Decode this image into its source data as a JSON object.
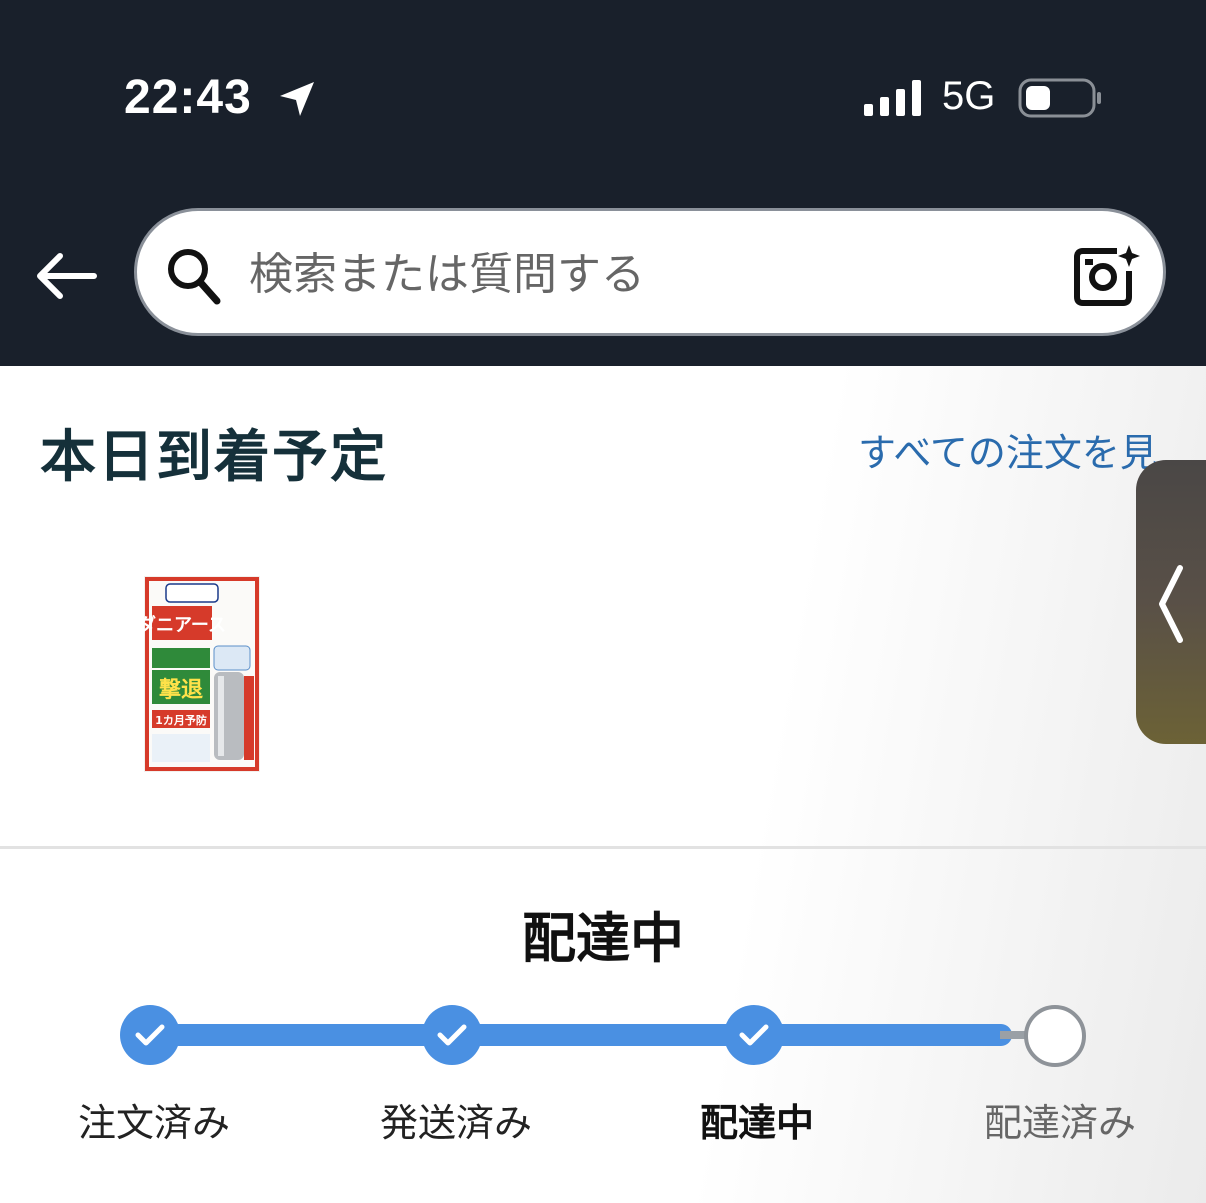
{
  "status_bar": {
    "time": "22:43",
    "network": "5G"
  },
  "search": {
    "placeholder": "検索または質問する"
  },
  "section": {
    "title": "本日到着予定",
    "all_orders_link": "すべての注文を見"
  },
  "product": {
    "image_text": {
      "brand": "ダニアース",
      "headline": "撃退",
      "subline": "1カ月予防"
    }
  },
  "tracking": {
    "status_heading": "配達中",
    "steps": [
      {
        "label": "注文済み",
        "state": "done"
      },
      {
        "label": "発送済み",
        "state": "done"
      },
      {
        "label": "配達中",
        "state": "current"
      },
      {
        "label": "配達済み",
        "state": "pending"
      }
    ],
    "accent_color": "#4a90e2"
  }
}
